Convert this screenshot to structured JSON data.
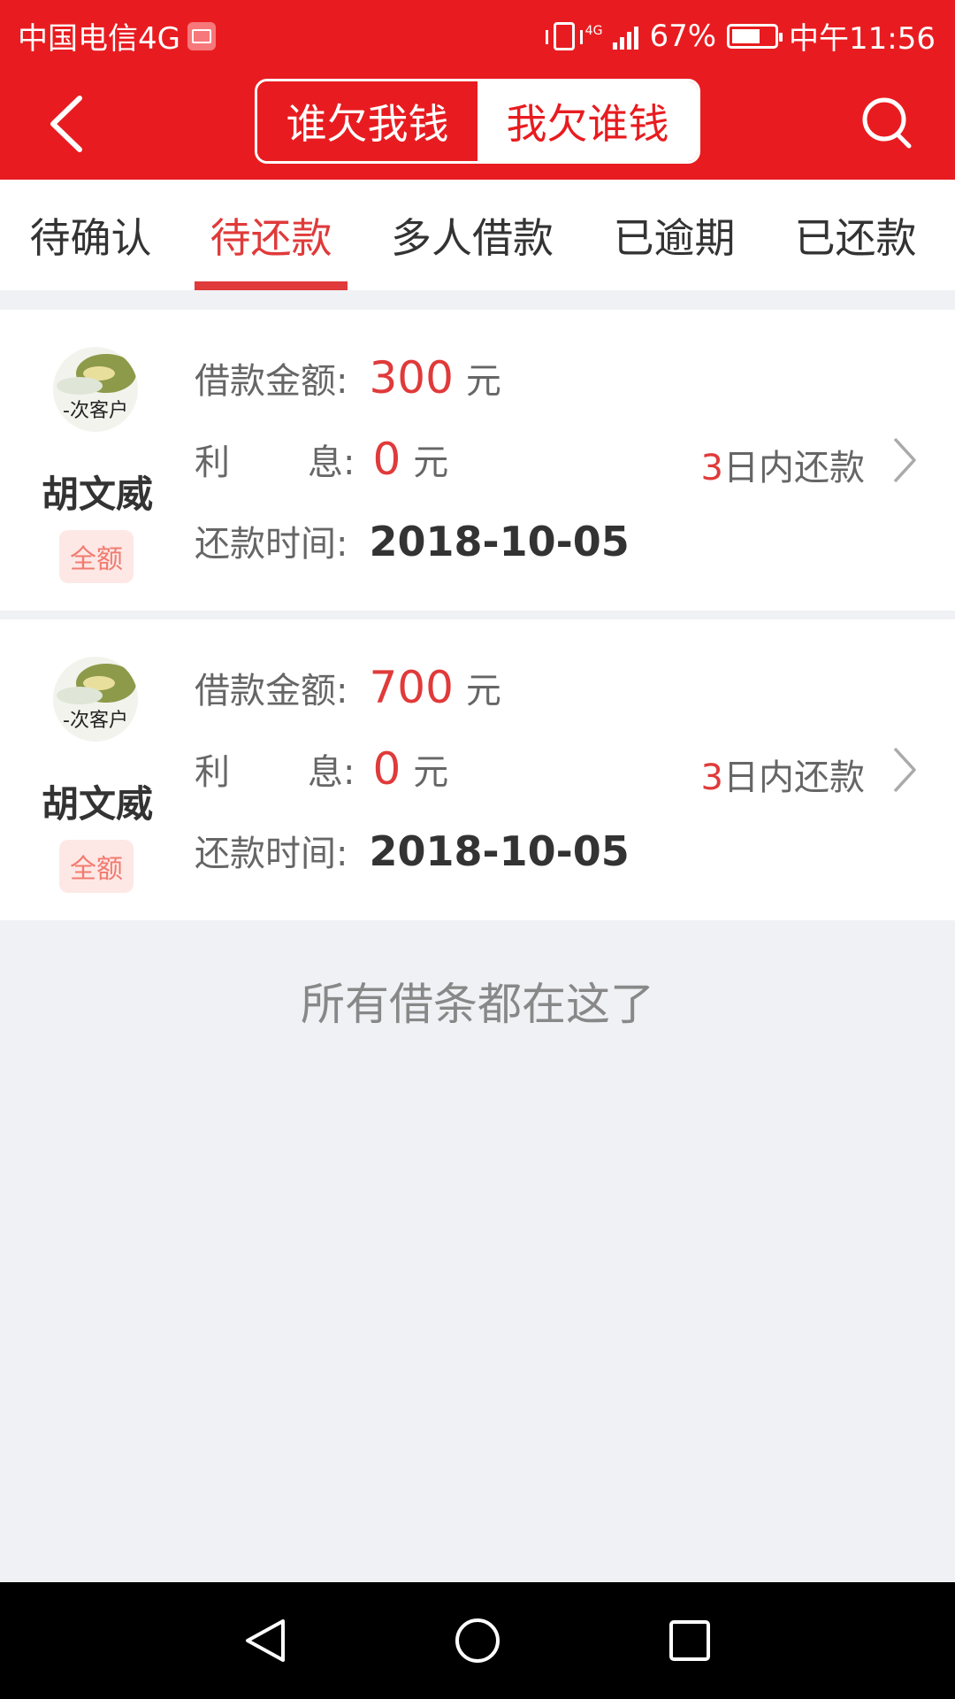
{
  "status_bar": {
    "carrier": "中国电信4G",
    "network": "4G",
    "battery": "67%",
    "battery_level": 0.67,
    "time": "中午11:56"
  },
  "header": {
    "segments": [
      {
        "label": "谁欠我钱",
        "active": true
      },
      {
        "label": "我欠谁钱",
        "active": false
      }
    ]
  },
  "tabs": [
    {
      "label": "待确认"
    },
    {
      "label": "待还款",
      "active": true
    },
    {
      "label": "多人借款"
    },
    {
      "label": "已逾期"
    },
    {
      "label": "已还款"
    }
  ],
  "loans": [
    {
      "avatar_text": "-次客户",
      "name": "胡文威",
      "badge": "全额",
      "amount_label": "借款金额:",
      "amount": "300",
      "amount_unit": "元",
      "interest_label_a": "利",
      "interest_label_b": "息",
      "interest_colon": ":",
      "interest": "0",
      "interest_unit": "元",
      "due_days": "3",
      "due_suffix": "日内还款",
      "date_label": "还款时间:",
      "date": "2018-10-05"
    },
    {
      "avatar_text": "-次客户",
      "name": "胡文威",
      "badge": "全额",
      "amount_label": "借款金额:",
      "amount": "700",
      "amount_unit": "元",
      "interest_label_a": "利",
      "interest_label_b": "息",
      "interest_colon": ":",
      "interest": "0",
      "interest_unit": "元",
      "due_days": "3",
      "due_suffix": "日内还款",
      "date_label": "还款时间:",
      "date": "2018-10-05"
    }
  ],
  "footer_text": "所有借条都在这了",
  "colors": {
    "brand_red": "#e81c20",
    "accent_red": "#e03a3a",
    "background": "#f0f1f5"
  },
  "icons": {
    "back": "chevron-left-icon",
    "search": "search-icon",
    "row_arrow": "chevron-right-icon",
    "nav_back": "triangle-back-icon",
    "nav_home": "circle-home-icon",
    "nav_recent": "square-recent-icon"
  }
}
